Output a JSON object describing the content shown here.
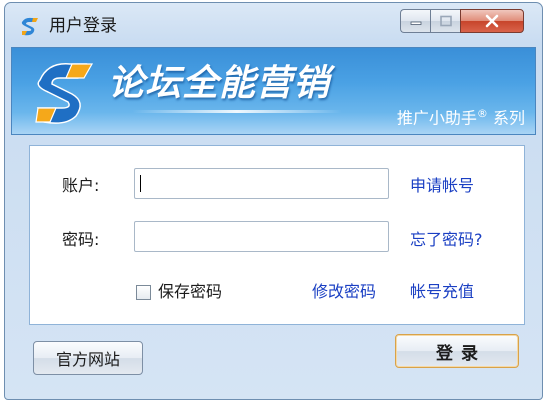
{
  "window": {
    "title": "用户登录"
  },
  "banner": {
    "title": "论坛全能营销",
    "subtitle_main": "推广小助手",
    "subtitle_mark": "®",
    "subtitle_suffix": " 系列"
  },
  "form": {
    "account_label": "账户:",
    "account_value": "",
    "password_label": "密码:",
    "password_value": "",
    "register_link": "申请帐号",
    "forgot_link": "忘了密码?",
    "remember_label": "保存密码",
    "remember_checked": false,
    "change_password_link": "修改密码",
    "recharge_link": "帐号充值"
  },
  "buttons": {
    "website_label": "官方网站",
    "login_label": "登录"
  },
  "colors": {
    "link": "#1a3fc3",
    "banner_top": "#3a8fd8",
    "close_button": "#c7452b",
    "login_border": "#d8a24a"
  },
  "icons": {
    "app": "swirl-logo-icon",
    "minimize": "minimize-icon",
    "maximize": "maximize-icon",
    "close": "close-icon"
  }
}
